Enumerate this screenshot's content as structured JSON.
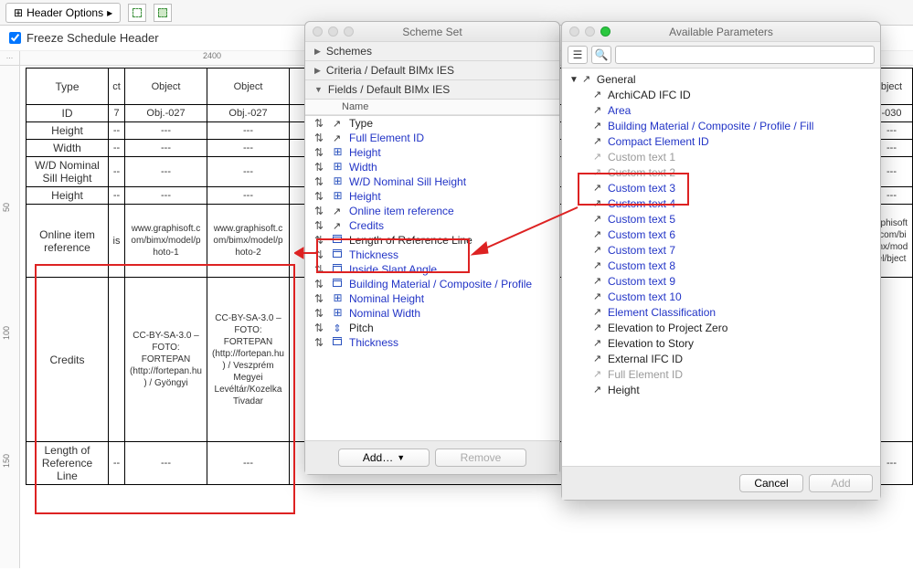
{
  "toolbar": {
    "header_options": "Header Options",
    "freeze": "Freeze Schedule Header"
  },
  "ruler": {
    "h": "2400",
    "corner": "...",
    "v": [
      "50",
      "100",
      "150"
    ]
  },
  "schedule": {
    "cols": {
      "type": "Type",
      "c1": "ct",
      "obj_a": "Object",
      "obj_b": "Object",
      "obj_tail": "bject"
    },
    "rows": [
      {
        "label": "ID",
        "c1": "7",
        "a": "Obj.-027",
        "b": "Obj.-027",
        "tail": "-030"
      },
      {
        "label": "Height",
        "c1": "--",
        "a": "---",
        "b": "---",
        "tail": "---"
      },
      {
        "label": "Width",
        "c1": "--",
        "a": "---",
        "b": "---",
        "tail": "---"
      },
      {
        "label": "W/D Nominal Sill Height",
        "c1": "--",
        "a": "---",
        "b": "---",
        "tail": "---"
      },
      {
        "label": "Height",
        "c1": "--",
        "a": "---",
        "b": "---",
        "tail": "---"
      },
      {
        "label": "Online item reference",
        "c1": "is",
        "a": "www.graphisoft.com/bimx/model/photo-1",
        "b": "www.graphisoft.com/bimx/model/photo-2",
        "tail": "aphisoft.com/bimx/model/bject"
      },
      {
        "label": "Credits",
        "c1": "",
        "a": "CC-BY-SA-3.0 – FOTO: FORTEPAN (http://fortepan.hu) / Gyöngyi",
        "b": "CC-BY-SA-3.0 – FOTO: FORTEPAN (http://fortepan.hu) / Veszprém Megyei Levéltár/Kozelka Tivadar",
        "tail": ""
      },
      {
        "label": "Length of Reference Line",
        "c1": "--",
        "a": "---",
        "b": "---",
        "tail": "---"
      }
    ]
  },
  "scheme_panel": {
    "title": "Scheme Set",
    "sections": {
      "schemes": "Schemes",
      "criteria": "Criteria /  Default BIMx IES",
      "fields": "Fields /  Default BIMx IES"
    },
    "list_header": "Name",
    "fields": [
      {
        "t": "Type",
        "blue": false,
        "icon": "cursor"
      },
      {
        "t": "Full Element ID",
        "blue": true,
        "icon": "cursor"
      },
      {
        "t": "Height",
        "blue": true,
        "icon": "grid"
      },
      {
        "t": "Width",
        "blue": true,
        "icon": "grid"
      },
      {
        "t": "W/D Nominal Sill Height",
        "blue": true,
        "icon": "grid"
      },
      {
        "t": "Height",
        "blue": true,
        "icon": "grid"
      },
      {
        "t": "Online item reference",
        "blue": true,
        "icon": "cursor"
      },
      {
        "t": "Credits",
        "blue": true,
        "icon": "cursor"
      },
      {
        "t": "Length of Reference Line",
        "blue": false,
        "icon": "stack"
      },
      {
        "t": "Thickness",
        "blue": true,
        "icon": "stack"
      },
      {
        "t": "Inside Slant Angle",
        "blue": true,
        "icon": "stack"
      },
      {
        "t": "Building Material / Composite / Profile",
        "blue": true,
        "icon": "stack"
      },
      {
        "t": "Nominal Height",
        "blue": true,
        "icon": "grid"
      },
      {
        "t": "Nominal Width",
        "blue": true,
        "icon": "grid"
      },
      {
        "t": "Pitch",
        "blue": false,
        "icon": "arrows"
      },
      {
        "t": "Thickness",
        "blue": true,
        "icon": "stack"
      }
    ],
    "add_btn": "Add…",
    "remove_btn": "Remove"
  },
  "param_panel": {
    "title": "Available Parameters",
    "root": "General",
    "items": [
      {
        "t": "ArchiCAD IFC ID",
        "s": "black"
      },
      {
        "t": "Area",
        "s": "blue"
      },
      {
        "t": "Building Material / Composite / Profile / Fill",
        "s": "blue"
      },
      {
        "t": "Compact Element ID",
        "s": "blue"
      },
      {
        "t": "Custom text  1",
        "s": "grey"
      },
      {
        "t": "Custom text  2",
        "s": "grey"
      },
      {
        "t": "Custom text  3",
        "s": "blue"
      },
      {
        "t": "Custom text  4",
        "s": "blue"
      },
      {
        "t": "Custom text  5",
        "s": "blue"
      },
      {
        "t": "Custom text  6",
        "s": "blue"
      },
      {
        "t": "Custom text  7",
        "s": "blue"
      },
      {
        "t": "Custom text  8",
        "s": "blue"
      },
      {
        "t": "Custom text  9",
        "s": "blue"
      },
      {
        "t": "Custom text 10",
        "s": "blue"
      },
      {
        "t": "Element Classification",
        "s": "blue"
      },
      {
        "t": "Elevation to Project Zero",
        "s": "black"
      },
      {
        "t": "Elevation to Story",
        "s": "black"
      },
      {
        "t": "External IFC ID",
        "s": "black"
      },
      {
        "t": "Full Element ID",
        "s": "grey"
      },
      {
        "t": "Height",
        "s": "black"
      }
    ],
    "cancel": "Cancel",
    "add": "Add"
  }
}
